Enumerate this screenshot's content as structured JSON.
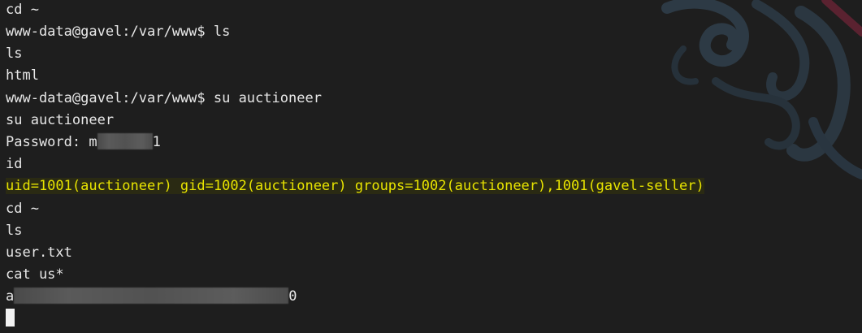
{
  "terminal": {
    "lines": [
      "cd ~",
      "www-data@gavel:/var/www$ ls",
      "ls",
      "html",
      "www-data@gavel:/var/www$ su auctioneer",
      "su auctioneer",
      "id",
      "uid=1001(auctioneer) gid=1002(auctioneer) groups=1002(auctioneer),1001(gavel-seller)",
      "cd ~",
      "ls",
      "user.txt",
      "cat us*"
    ],
    "password_prefix": "Password: m",
    "password_suffix": "1",
    "flag_prefix": "a",
    "flag_suffix": "0"
  },
  "colors": {
    "background": "#1e1e1e",
    "text": "#e8e8e8",
    "highlight_text": "#e8e400"
  }
}
